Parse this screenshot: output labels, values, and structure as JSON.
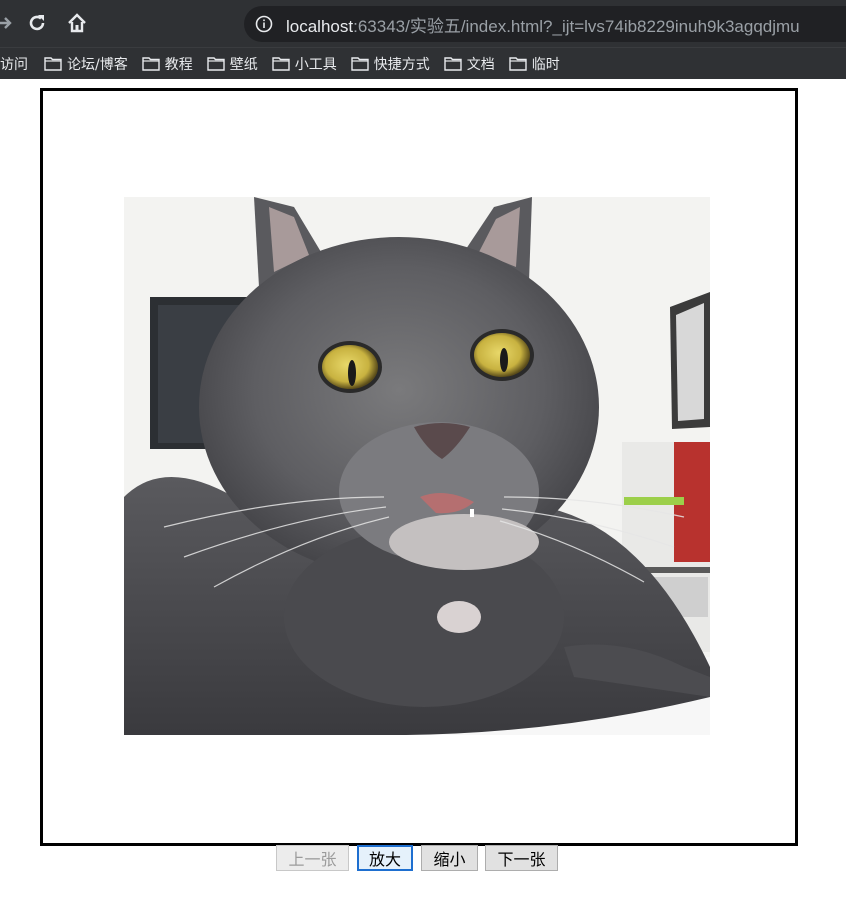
{
  "browser": {
    "url_host": "localhost",
    "url_rest": ":63343/实验五/index.html?_ijt=lvs74ib8229inuh9k3agqdjmu",
    "icons": [
      "forward-icon",
      "reload-icon",
      "home-icon",
      "info-icon"
    ]
  },
  "bookmarks": {
    "items": [
      "访问",
      "论坛/博客",
      "教程",
      "壁纸",
      "小工具",
      "快捷方式",
      "文档",
      "临时"
    ]
  },
  "viewer": {
    "image_subject": "gray cat with wide yellow eyes"
  },
  "controls": {
    "prev_label": "上一张",
    "zoom_in_label": "放大",
    "zoom_out_label": "缩小",
    "next_label": "下一张"
  }
}
